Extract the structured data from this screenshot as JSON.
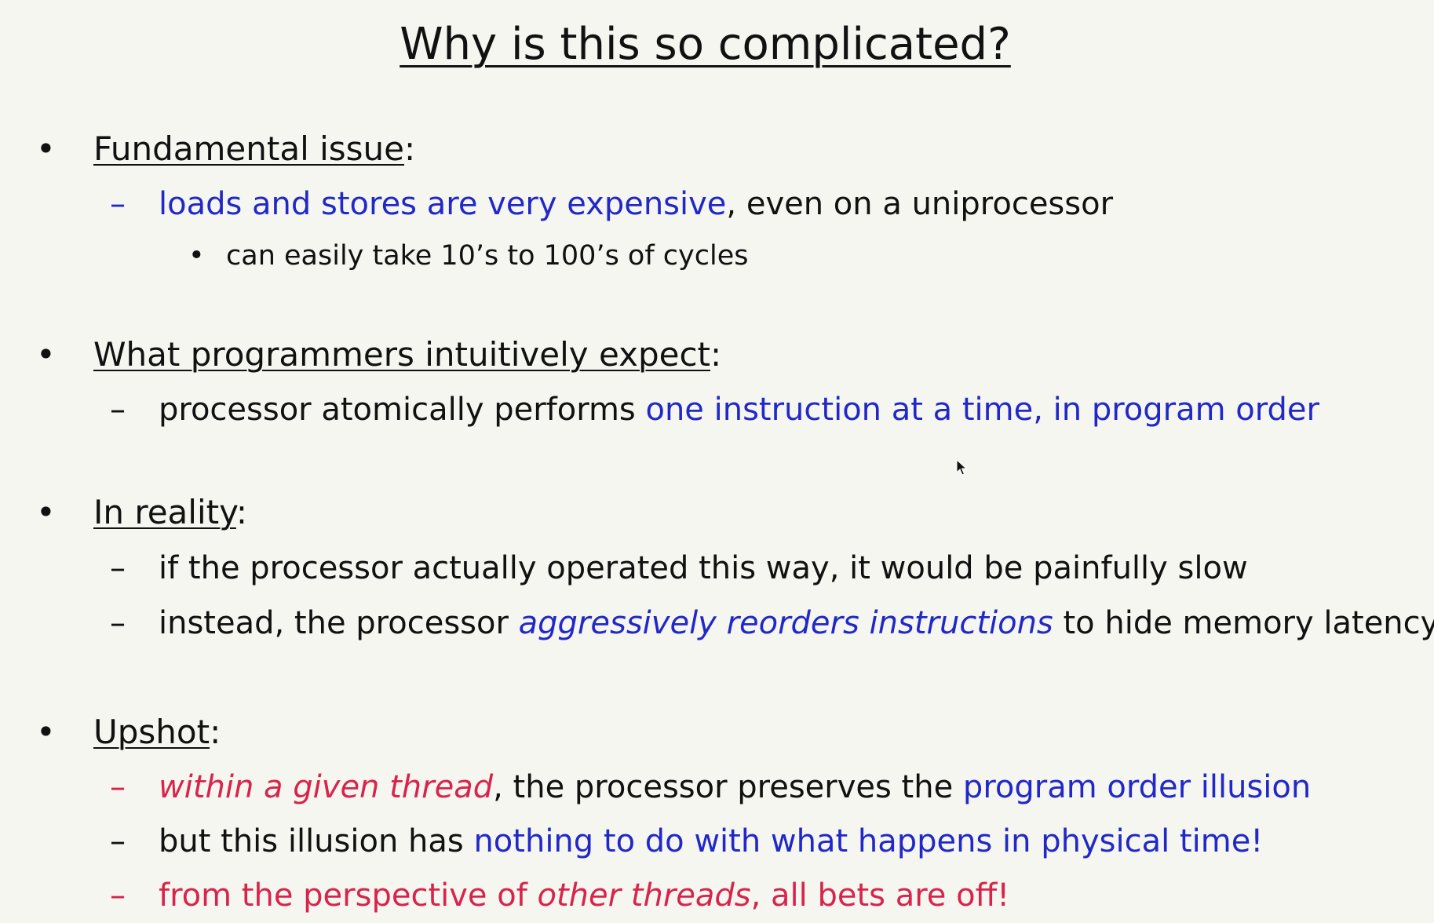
{
  "title": "Why is this so complicated?",
  "markers": {
    "bullet": "•",
    "dash": "–"
  },
  "sections": {
    "fundamental": {
      "heading": "Fundamental issue",
      "colon": ":",
      "item1": {
        "blue": "loads and stores are very expensive",
        "rest": ", even on a uniprocessor"
      },
      "sub1": "can easily take 10’s to 100’s of cycles"
    },
    "expect": {
      "heading": "What programmers intuitively expect",
      "colon": ":",
      "item1": {
        "plain": "processor atomically performs ",
        "blue": "one instruction at a time, in program order"
      }
    },
    "reality": {
      "heading": "In reality",
      "colon": ":",
      "item1": "if the processor actually operated this way, it would be painfully slow",
      "item2": {
        "plain": "instead, the processor ",
        "blue_italic": "aggressively reorders instructions",
        "rest": " to hide memory latency"
      }
    },
    "upshot": {
      "heading": "Upshot",
      "colon": ":",
      "item1": {
        "red_italic": "within a given thread",
        "plain": ", the processor preserves the ",
        "blue": "program order illusion"
      },
      "item2": {
        "plain": "but this illusion has ",
        "blue": "nothing to do with what happens in physical time!"
      },
      "item3": {
        "red1": "from the perspective of ",
        "red_italic": "other threads",
        "red2": ", all bets are off!"
      }
    }
  },
  "colors": {
    "text": "#111111",
    "blue": "#2228c8",
    "red": "#d8244c",
    "background": "#f4f6ef"
  }
}
